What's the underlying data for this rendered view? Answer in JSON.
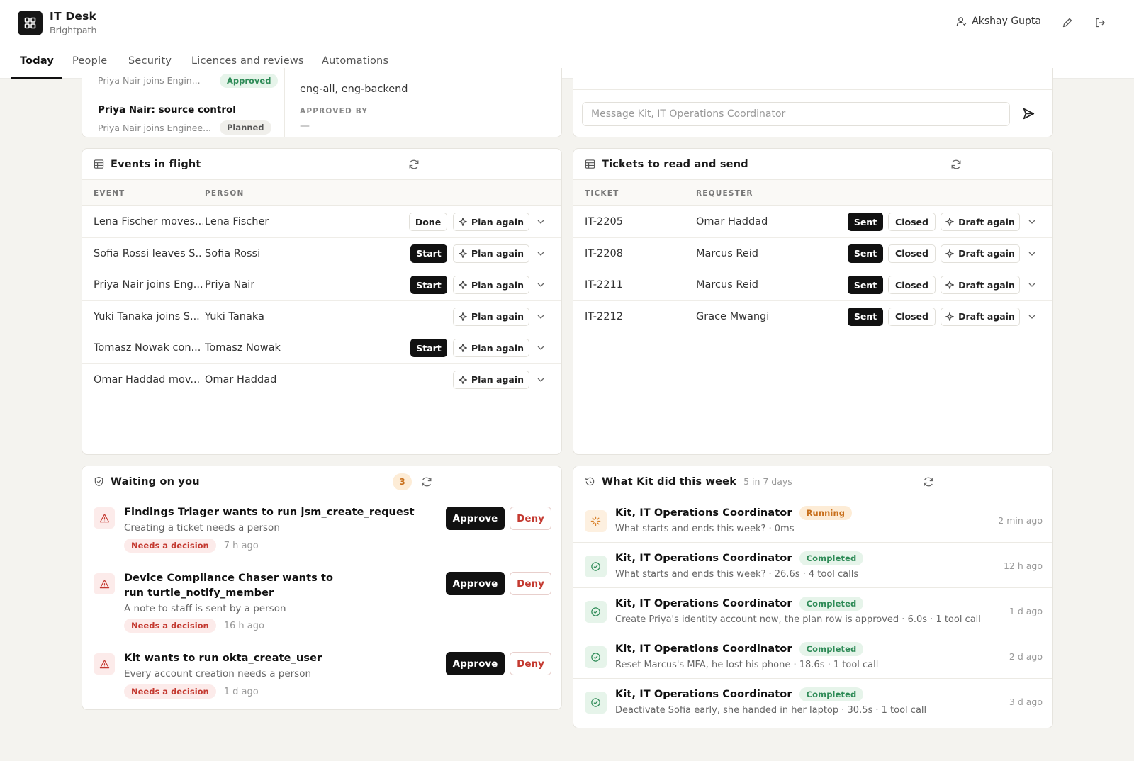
{
  "app": {
    "title": "IT Desk",
    "subtitle": "Brightpath"
  },
  "user": {
    "name": "Akshay Gupta"
  },
  "tabs": [
    "Today",
    "People",
    "Security",
    "Licences and reviews",
    "Automations"
  ],
  "plan_panel": {
    "items": [
      {
        "title": "",
        "sub": "Priya Nair joins Engin...",
        "status": "Approved"
      },
      {
        "title": "Priya Nair: source control",
        "sub": "Priya Nair joins Enginee...",
        "status": "Planned"
      }
    ],
    "detail_value": "eng-all, eng-backend",
    "approved_by_label": "APPROVED BY",
    "approved_by_value": "—"
  },
  "chat": {
    "placeholder": "Message Kit, IT Operations Coordinator"
  },
  "events": {
    "title": "Events in flight",
    "columns": [
      "EVENT",
      "PERSON"
    ],
    "plan_label": "Plan again",
    "rows": [
      {
        "event": "Lena Fischer moves...",
        "person": "Lena Fischer",
        "action": "Done"
      },
      {
        "event": "Sofia Rossi leaves S...",
        "person": "Sofia Rossi",
        "action": "Start"
      },
      {
        "event": "Priya Nair joins Eng...",
        "person": "Priya Nair",
        "action": "Start"
      },
      {
        "event": "Yuki Tanaka joins S...",
        "person": "Yuki Tanaka",
        "action": ""
      },
      {
        "event": "Tomasz Nowak con...",
        "person": "Tomasz Nowak",
        "action": "Start"
      },
      {
        "event": "Omar Haddad mov...",
        "person": "Omar Haddad",
        "action": ""
      }
    ]
  },
  "tickets": {
    "title": "Tickets to read and send",
    "columns": [
      "TICKET",
      "REQUESTER"
    ],
    "sent_label": "Sent",
    "closed_label": "Closed",
    "draft_label": "Draft again",
    "rows": [
      {
        "id": "IT-2205",
        "requester": "Omar Haddad"
      },
      {
        "id": "IT-2208",
        "requester": "Marcus Reid"
      },
      {
        "id": "IT-2211",
        "requester": "Marcus Reid"
      },
      {
        "id": "IT-2212",
        "requester": "Grace Mwangi"
      }
    ]
  },
  "waiting": {
    "title": "Waiting on you",
    "count": "3",
    "approve_label": "Approve",
    "deny_label": "Deny",
    "items": [
      {
        "title": "Findings Triager wants to run jsm_create_request",
        "desc": "Creating a ticket needs a person",
        "badge": "Needs a decision",
        "time": "7 h ago"
      },
      {
        "title": "Device Compliance Chaser wants to run turtle_notify_member",
        "desc": "A note to staff is sent by a person",
        "badge": "Needs a decision",
        "time": "16 h ago"
      },
      {
        "title": "Kit wants to run okta_create_user",
        "desc": "Every account creation needs a person",
        "badge": "Needs a decision",
        "time": "1 d ago"
      }
    ]
  },
  "activity": {
    "title": "What Kit did this week",
    "summary": "5 in 7 days",
    "items": [
      {
        "agent": "Kit, IT Operations Coordinator",
        "status": "Running",
        "desc": "What starts and ends this week? · 0ms",
        "time": "2 min ago"
      },
      {
        "agent": "Kit, IT Operations Coordinator",
        "status": "Completed",
        "desc": "What starts and ends this week? · 26.6s · 4 tool calls",
        "time": "12 h ago"
      },
      {
        "agent": "Kit, IT Operations Coordinator",
        "status": "Completed",
        "desc": "Create Priya's identity account now, the plan row is approved · 6.0s · 1 tool call",
        "time": "1 d ago"
      },
      {
        "agent": "Kit, IT Operations Coordinator",
        "status": "Completed",
        "desc": "Reset Marcus's MFA, he lost his phone · 18.6s · 1 tool call",
        "time": "2 d ago"
      },
      {
        "agent": "Kit, IT Operations Coordinator",
        "status": "Completed",
        "desc": "Deactivate Sofia early, she handed in her laptop · 30.5s · 1 tool call",
        "time": "3 d ago"
      }
    ]
  },
  "colors": {
    "accent": "#111111",
    "danger": "#c43a31",
    "success": "#2e8b57",
    "running": "#d9822b"
  }
}
